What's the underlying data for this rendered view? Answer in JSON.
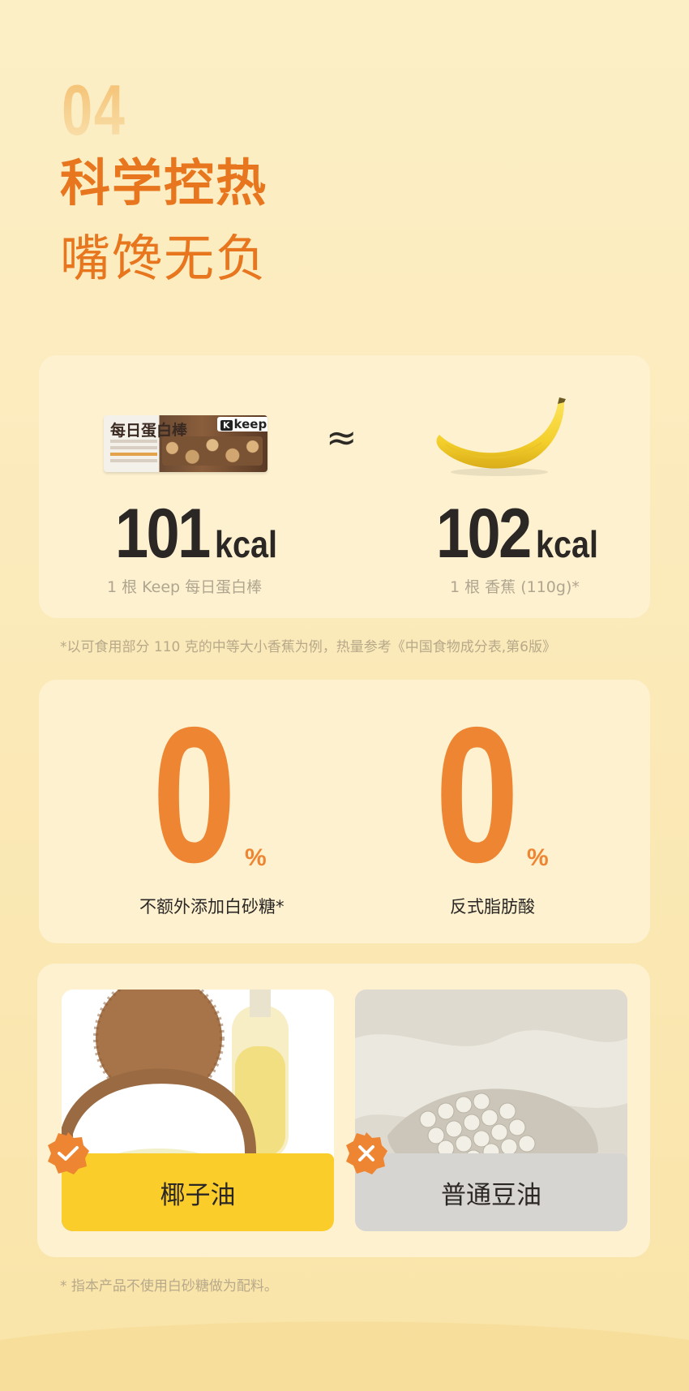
{
  "header": {
    "section_number": "04",
    "title_line1": "科学控热",
    "title_line2": "嘴馋无负"
  },
  "calorie_compare": {
    "product_image_text": {
      "name": "每日蛋白棒",
      "brand": "keep"
    },
    "approx_symbol": "≈",
    "left": {
      "value": "101",
      "unit": "kcal",
      "caption": "1 根 Keep 每日蛋白棒"
    },
    "right": {
      "value": "102",
      "unit": "kcal",
      "caption": "1 根 香蕉 (110g)*"
    },
    "banana_icon": "banana-image"
  },
  "footnote_calorie": "*以可食用部分 110 克的中等大小香蕉为例，热量参考《中国食物成分表,第6版》",
  "zero_stats": [
    {
      "value": "0",
      "unit": "%",
      "label": "不额外添加白砂糖*"
    },
    {
      "value": "0",
      "unit": "%",
      "label": "反式脂肪酸"
    }
  ],
  "oil_compare": [
    {
      "label": "椰子油",
      "status_icon": "check-icon",
      "accent": "#fbcd2a"
    },
    {
      "label": "普通豆油",
      "status_icon": "cross-icon",
      "accent": "#d7d5d1"
    }
  ],
  "footnote_sugar": "* 指本产品不使用白砂糖做为配料。",
  "colors": {
    "orange": "#e7761e",
    "zero_orange": "#ee8532",
    "card_bg": "#fdf1cf",
    "badge_orange": "#ee8532"
  }
}
